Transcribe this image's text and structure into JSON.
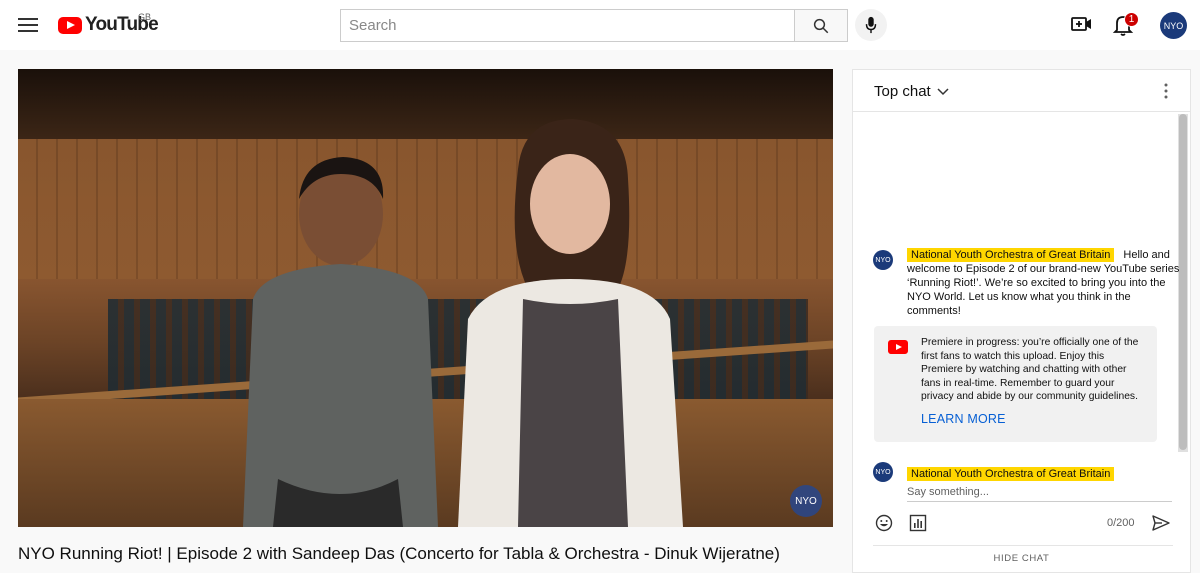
{
  "header": {
    "logo_text": "YouTube",
    "region": "GB",
    "search_placeholder": "Search",
    "notification_count": "1",
    "avatar_text": "NYO"
  },
  "video": {
    "title": "NYO Running Riot! | Episode 2 with Sandeep Das (Concerto for Tabla & Orchestra - Dinuk Wijeratne)",
    "watermark_text": "NYO"
  },
  "chat": {
    "mode_label": "Top chat",
    "message": {
      "author": "National Youth Orchestra of Great Britain",
      "text": "Hello and welcome to Episode 2 of our brand-new YouTube series ‘Running Riot!’. We’re so excited to bring you into the NYO World. Let us know what you think in the comments!",
      "avatar_text": "NYO"
    },
    "notice": {
      "text": "Premiere in progress: you’re officially one of the first fans to watch this upload. Enjoy this Premiere by watching and chatting with other fans in real-time. Remember to guard your privacy and abide by our community guidelines.",
      "link_label": "LEARN MORE"
    },
    "compose": {
      "author": "National Youth Orchestra of Great Britain",
      "placeholder": "Say something...",
      "counter": "0/200",
      "avatar_text": "NYO"
    },
    "hide_label": "HIDE CHAT"
  },
  "colors": {
    "brand_red": "#ff0000",
    "link_blue": "#065fd4",
    "author_highlight": "#ffd600",
    "channel_avatar": "#1b3a7a"
  }
}
